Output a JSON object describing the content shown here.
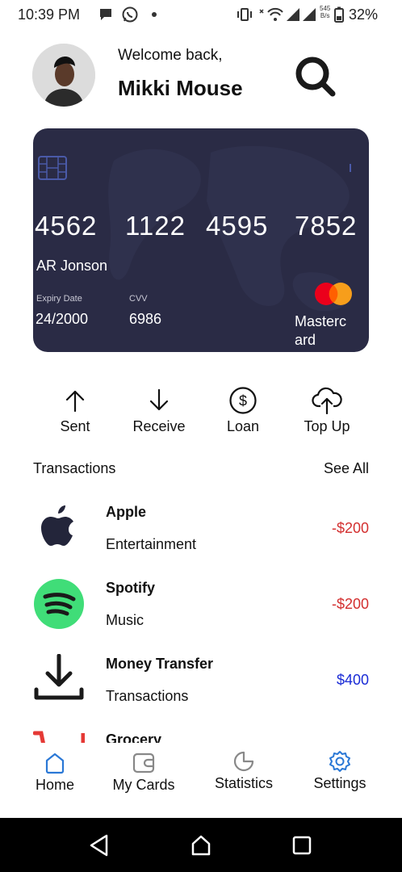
{
  "status_bar": {
    "time": "10:39 PM",
    "speed_top": "545",
    "speed_bottom": "B/s",
    "battery": "32%"
  },
  "header": {
    "welcome": "Welcome back,",
    "user_name": "Mikki Mouse"
  },
  "card": {
    "number_groups": [
      "4562",
      "1122",
      "4595",
      "7852"
    ],
    "holder": "AR Jonson",
    "expiry_label": "Expiry Date",
    "expiry_value": "24/2000",
    "cvv_label": "CVV",
    "cvv_value": "6986",
    "brand": "Masterc ard",
    "colors": {
      "background": "#2a2b45",
      "mc_red": "#eb001b",
      "mc_orange": "#f79e1b"
    }
  },
  "actions": [
    {
      "label": "Sent",
      "icon": "arrow-up-icon"
    },
    {
      "label": "Receive",
      "icon": "arrow-down-icon"
    },
    {
      "label": "Loan",
      "icon": "dollar-circle-icon"
    },
    {
      "label": "Top Up",
      "icon": "cloud-upload-icon"
    }
  ],
  "transactions": {
    "title": "Transactions",
    "see_all": "See All",
    "items": [
      {
        "name": "Apple",
        "category": "Entertainment",
        "amount": "-$200",
        "amount_color": "#d32f2f",
        "icon": "apple-logo-icon"
      },
      {
        "name": "Spotify",
        "category": "Music",
        "amount": "-$200",
        "amount_color": "#d32f2f",
        "icon": "spotify-logo-icon"
      },
      {
        "name": "Money Transfer",
        "category": "Transactions",
        "amount": "$400",
        "amount_color": "#1a2bd6",
        "icon": "download-icon"
      },
      {
        "name": "Grocery",
        "category": "",
        "amount": "",
        "amount_color": "#d32f2f",
        "icon": "cart-icon"
      }
    ]
  },
  "bottom_nav": [
    {
      "label": "Home",
      "icon": "home-icon",
      "active": true
    },
    {
      "label": "My Cards",
      "icon": "wallet-icon",
      "active": false
    },
    {
      "label": "Statistics",
      "icon": "pie-chart-icon",
      "active": false
    },
    {
      "label": "Settings",
      "icon": "gear-icon",
      "active": true
    }
  ],
  "accent_color": "#2a78d6"
}
